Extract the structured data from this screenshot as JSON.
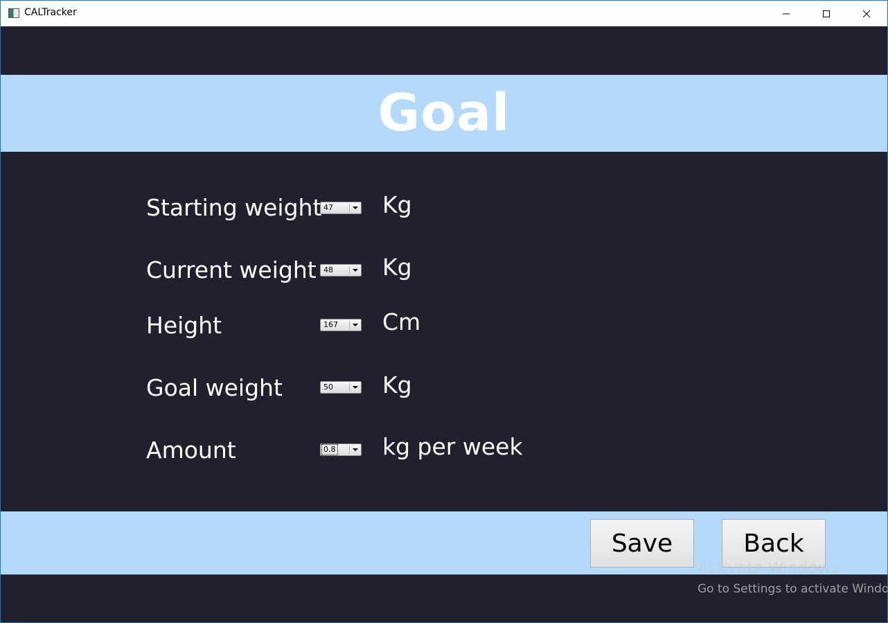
{
  "window": {
    "title": "CALTracker",
    "controls": {
      "minimize": "minimize",
      "maximize": "maximize",
      "close": "close"
    }
  },
  "header": {
    "title": "Goal"
  },
  "form": {
    "fields": [
      {
        "label": "Starting weight",
        "value": "47",
        "unit": "Kg"
      },
      {
        "label": "Current weight",
        "value": "48",
        "unit": "Kg"
      },
      {
        "label": "Height",
        "value": "167",
        "unit": "Cm"
      },
      {
        "label": "Goal weight",
        "value": "50",
        "unit": "Kg"
      },
      {
        "label": "Amount",
        "value": "0.8",
        "unit": "kg per week"
      }
    ]
  },
  "footer": {
    "save_label": "Save",
    "back_label": "Back"
  },
  "watermark": {
    "title": "Activate Windows",
    "subtitle": "Go to Settings to activate Windows."
  },
  "colors": {
    "background": "#21202e",
    "band": "#b3d9fd",
    "text": "#ffffff"
  }
}
